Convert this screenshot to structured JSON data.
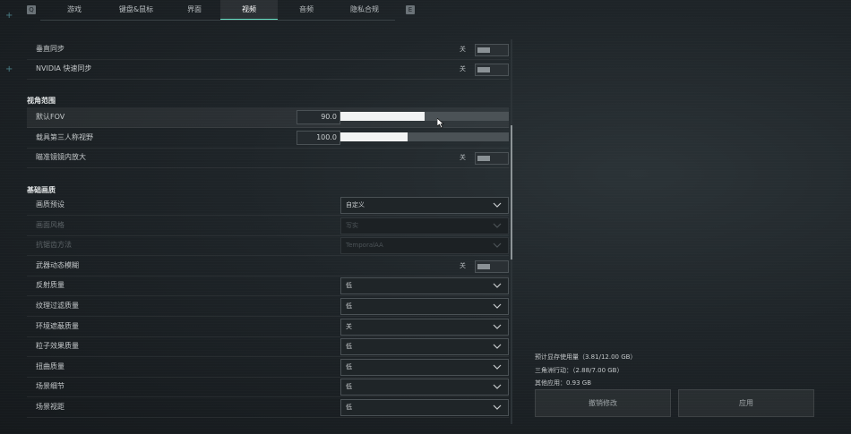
{
  "tabs": {
    "left_key": "Q",
    "right_key": "E",
    "items": [
      "游戏",
      "键盘&鼠标",
      "界面",
      "视频",
      "音频",
      "隐私合规"
    ],
    "active_index": 3
  },
  "rows_top": [
    {
      "label": "垂直同步",
      "value": "关"
    },
    {
      "label": "NVIDIA 快速同步",
      "value": "关"
    }
  ],
  "section_fov": {
    "title": "视角范围",
    "fov": {
      "label": "默认FOV",
      "value": "90.0",
      "fill_fraction": 0.5
    },
    "vehicle_fov": {
      "label": "载具第三人称视野",
      "value": "100.0",
      "fill_fraction": 0.4
    },
    "scope": {
      "label": "瞄准镜镜内放大",
      "value": "关"
    }
  },
  "section_quality": {
    "title": "基础画质",
    "rows": [
      {
        "type": "dropdown",
        "label": "画质预设",
        "value": "自定义",
        "disabled": false
      },
      {
        "type": "dropdown",
        "label": "画面风格",
        "value": "写实",
        "disabled": true
      },
      {
        "type": "dropdown",
        "label": "抗锯齿方法",
        "value": "TemporalAA",
        "disabled": true
      },
      {
        "type": "toggle",
        "label": "武器动态模糊",
        "value": "关",
        "disabled": false
      },
      {
        "type": "dropdown",
        "label": "反射质量",
        "value": "低",
        "disabled": false
      },
      {
        "type": "dropdown",
        "label": "纹理过滤质量",
        "value": "低",
        "disabled": false
      },
      {
        "type": "dropdown",
        "label": "环境遮蔽质量",
        "value": "关",
        "disabled": false
      },
      {
        "type": "dropdown",
        "label": "粒子效果质量",
        "value": "低",
        "disabled": false
      },
      {
        "type": "dropdown",
        "label": "扭曲质量",
        "value": "低",
        "disabled": false
      },
      {
        "type": "dropdown",
        "label": "场景细节",
        "value": "低",
        "disabled": false
      },
      {
        "type": "dropdown",
        "label": "场景视距",
        "value": "低",
        "disabled": false
      }
    ]
  },
  "memory": {
    "estimate": "预计显存使用量（3.81/12.00 GB）",
    "game": "三角洲行动：（2.88/7.00 GB）",
    "other": "其他应用：0.93 GB"
  },
  "buttons": {
    "revert": "撤销修改",
    "apply": "应用"
  },
  "colors": {
    "accent": "#66e0c4",
    "panel_bg": "#1e2428"
  }
}
